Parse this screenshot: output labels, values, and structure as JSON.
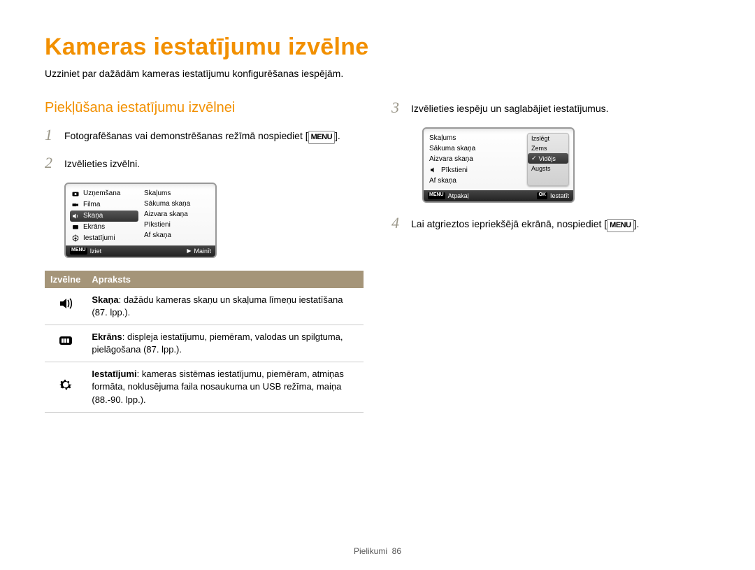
{
  "page": {
    "title": "Kameras iestatījumu izvēlne",
    "subtitle": "Uzziniet par dažādām kameras iestatījumu konfigurēšanas iespējām.",
    "section_heading": "Piekļūšana iestatījumu izvēlnei"
  },
  "steps": {
    "s1a": "Fotografēšanas vai demonstrēšanas režīmā nospiediet [",
    "s1b": "].",
    "s2": "Izvēlieties izvēlni.",
    "s3": "Izvēlieties iespēju un saglabājiet iestatījumus.",
    "s4a": "Lai atgrieztos iepriekšējā ekrānā, nospiediet [",
    "s4b": "]."
  },
  "menu_label": "MENU",
  "cam1": {
    "left": [
      "Uzņemšana",
      "Filma",
      "Skaņa",
      "Ekrāns",
      "Iestatījumi"
    ],
    "right": [
      "Skaļums",
      "Sākuma skaņa",
      "Aizvara skaņa",
      "Pīkstieni",
      "Af skaņa"
    ],
    "footer_left": "Iziet",
    "footer_right": "Mainīt"
  },
  "cam2": {
    "left": [
      "Skaļums",
      "Sākuma skaņa",
      "Aizvara skaņa",
      "Pīkstieni",
      "Af skaņa"
    ],
    "panel": [
      "Izslēgt",
      "Zems",
      "Vidējs",
      "Augsts"
    ],
    "footer_left": "Atpakaļ",
    "footer_right": "Iestatīt"
  },
  "table": {
    "col1": "Izvēlne",
    "col2": "Apraksts",
    "rows": [
      {
        "label": "Skaņa",
        "text": ": dažādu kameras skaņu un skaļuma līmeņu iestatīšana (87. lpp.)."
      },
      {
        "label": "Ekrāns",
        "text": ": displeja iestatījumu, piemēram, valodas un spilgtuma, pielāgošana (87. lpp.)."
      },
      {
        "label": "Iestatījumi",
        "text": ": kameras sistēmas iestatījumu, piemēram, atmiņas formāta, noklusējuma faila nosaukuma un USB režīma, maiņa (88.-90. lpp.)."
      }
    ]
  },
  "footer": {
    "section": "Pielikumi",
    "page": "86"
  }
}
